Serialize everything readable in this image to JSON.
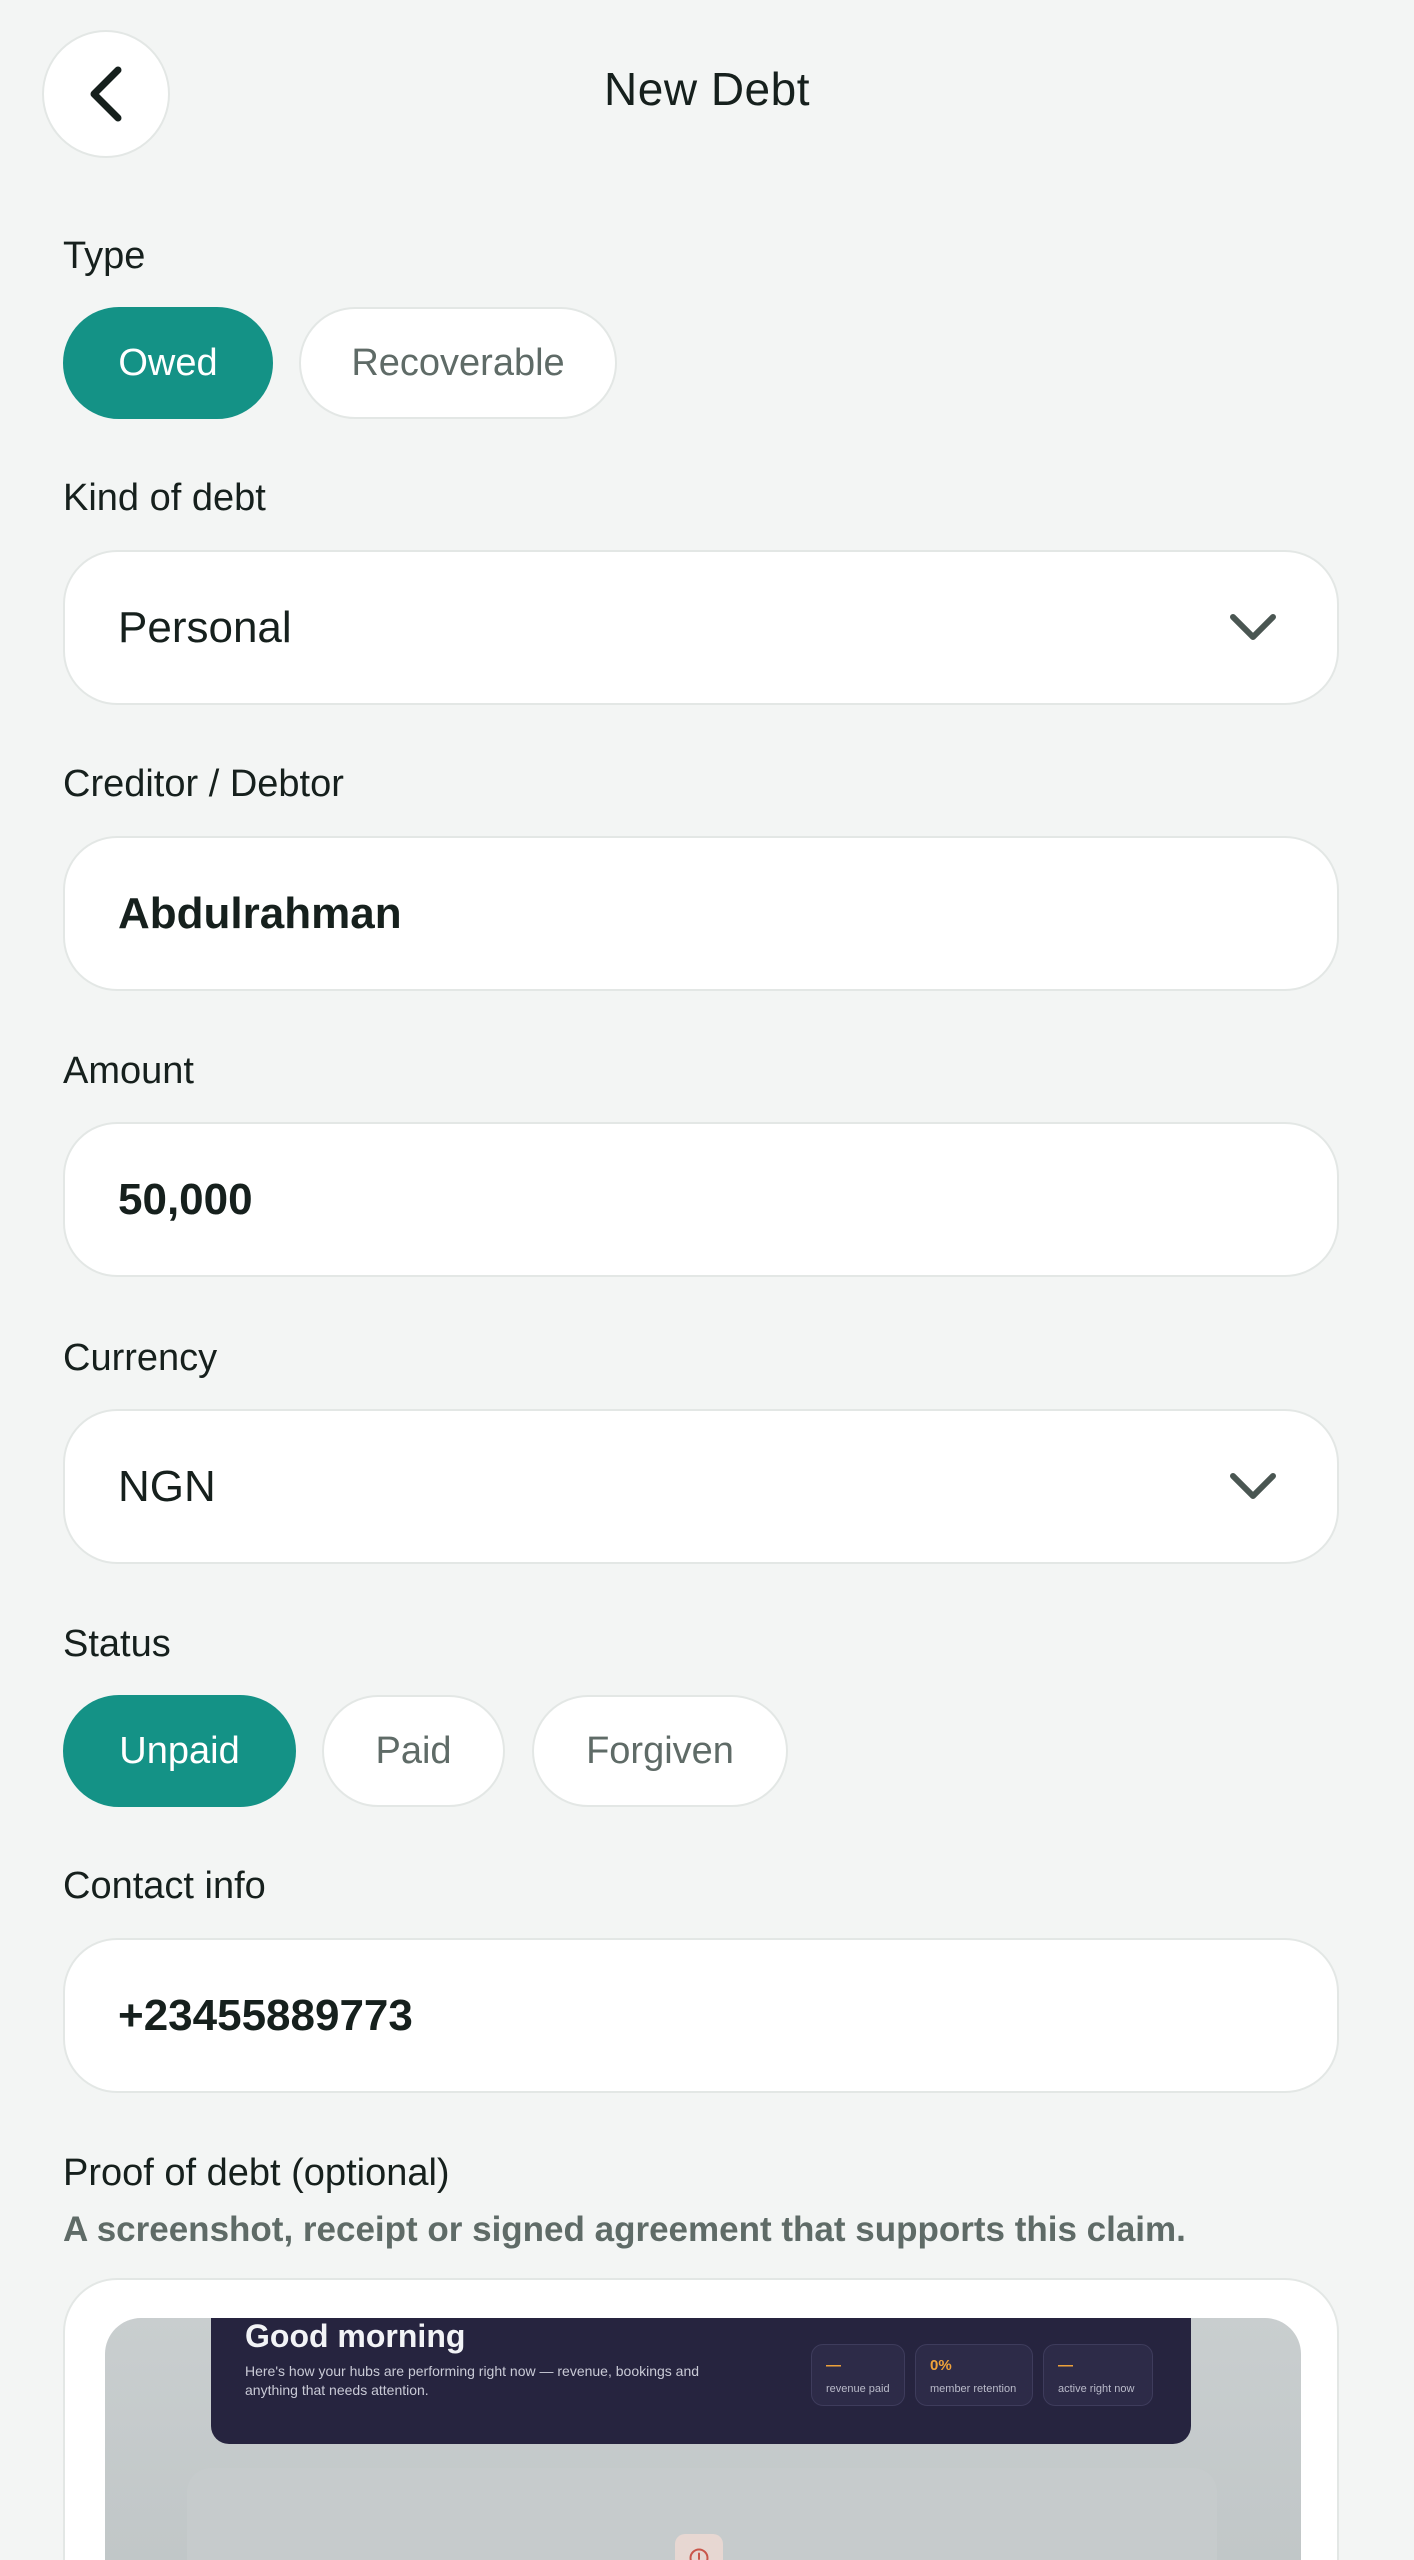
{
  "header": {
    "title": "New Debt",
    "back_icon": "chevron-left-icon"
  },
  "type": {
    "label": "Type",
    "options": [
      "Owed",
      "Recoverable"
    ],
    "selected": "Owed"
  },
  "kind": {
    "label": "Kind of debt",
    "value": "Personal",
    "icon": "chevron-down-icon"
  },
  "party": {
    "label": "Creditor / Debtor",
    "value": "Abdulrahman"
  },
  "amount": {
    "label": "Amount",
    "value": "50,000"
  },
  "currency": {
    "label": "Currency",
    "value": "NGN",
    "icon": "chevron-down-icon"
  },
  "status": {
    "label": "Status",
    "options": [
      "Unpaid",
      "Paid",
      "Forgiven"
    ],
    "selected": "Unpaid"
  },
  "contact": {
    "label": "Contact info",
    "value": "+23455889773"
  },
  "proof": {
    "label": "Proof of debt (optional)",
    "hint": "A screenshot, receipt or signed agreement that supports this claim.",
    "preview": {
      "greeting": "Good morning",
      "subtitle": "Here's how your hubs are performing right now — revenue, bookings and anything that needs attention.",
      "stats": [
        {
          "value": "—",
          "label": "revenue paid"
        },
        {
          "value": "0%",
          "label": "member retention"
        },
        {
          "value": "—",
          "label": "active right now"
        }
      ]
    }
  },
  "colors": {
    "accent": "#149286",
    "background": "#f3f5f4",
    "muted_text": "#5f6b67"
  }
}
